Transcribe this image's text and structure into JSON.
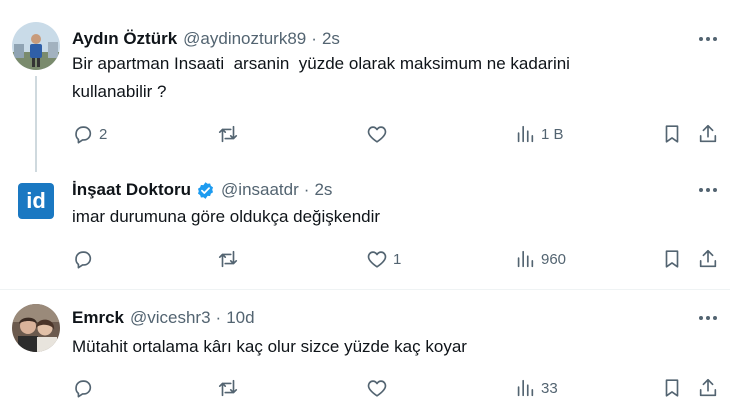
{
  "tweets": [
    {
      "name": "Aydın Öztürk",
      "handle": "@aydinozturk89",
      "dot": "·",
      "time": "2s",
      "text": "Bir apartman Insaati  arsanin  yüzde olarak maksimum ne kadarini\nkullanabilir ?",
      "replies": "2",
      "retweets": "",
      "likes": "",
      "views": "1 B",
      "verified": false
    },
    {
      "name": "İnşaat Doktoru",
      "handle": "@insaatdr",
      "dot": "·",
      "time": "2s",
      "text": "imar durumuna göre oldukça değişkendir",
      "replies": "",
      "retweets": "",
      "likes": "1",
      "views": "960",
      "verified": true,
      "avatar_label": "id"
    },
    {
      "name": "Emrck",
      "handle": "@viceshr3",
      "dot": "·",
      "time": "10d",
      "text": "Mütahit ortalama kârı kaç olur sizce yüzde kaç koyar",
      "replies": "",
      "retweets": "",
      "likes": "",
      "views": "33",
      "verified": false
    }
  ],
  "colors": {
    "text": "#0f1419",
    "secondary": "#536471",
    "verified_blue": "#1d9bf0",
    "brand_avatar": "#1a78c2",
    "divider": "#eff3f4",
    "thread_line": "#cfd9de"
  },
  "icons": {
    "more": "more-dots-icon",
    "reply": "reply-bubble-icon",
    "retweet": "retweet-icon",
    "like": "heart-icon",
    "views": "views-chart-icon",
    "bookmark": "bookmark-icon",
    "share": "share-icon",
    "verified": "verified-badge-icon"
  }
}
